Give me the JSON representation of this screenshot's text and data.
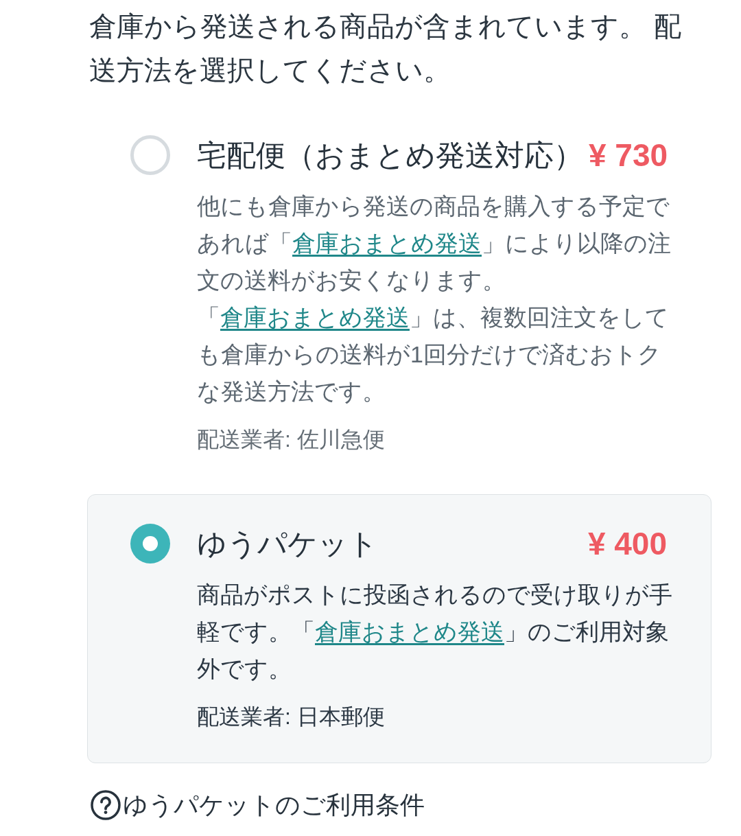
{
  "instruction": "倉庫から発送される商品が含まれています。 配送方法を選択してください。",
  "options": [
    {
      "title": "宅配便（おまとめ発送対応）",
      "price": "¥ 730",
      "selected": false,
      "paragraphs": [
        [
          {
            "kind": "text",
            "text": "他にも倉庫から発送の商品を購入する予定であれば「"
          },
          {
            "kind": "link",
            "text": "倉庫おまとめ発送"
          },
          {
            "kind": "text",
            "text": "」により以降の注文の送料がお安くなります。"
          }
        ],
        [
          {
            "kind": "text",
            "text": "「"
          },
          {
            "kind": "link",
            "text": "倉庫おまとめ発送"
          },
          {
            "kind": "text",
            "text": "」は、複数回注文をしても倉庫からの送料が1回分だけで済むおトクな発送方法です。"
          }
        ]
      ],
      "carrier": "配送業者: 佐川急便"
    },
    {
      "title": "ゆうパケット",
      "price": "¥ 400",
      "selected": true,
      "paragraphs": [
        [
          {
            "kind": "text",
            "text": "商品がポストに投函されるので受け取りが手軽です。「"
          },
          {
            "kind": "link",
            "text": "倉庫おまとめ発送"
          },
          {
            "kind": "text",
            "text": "」のご利用対象外です。"
          }
        ]
      ],
      "carrier": "配送業者: 日本郵便"
    }
  ],
  "help_link": {
    "label": "ゆうパケットのご利用条件"
  }
}
